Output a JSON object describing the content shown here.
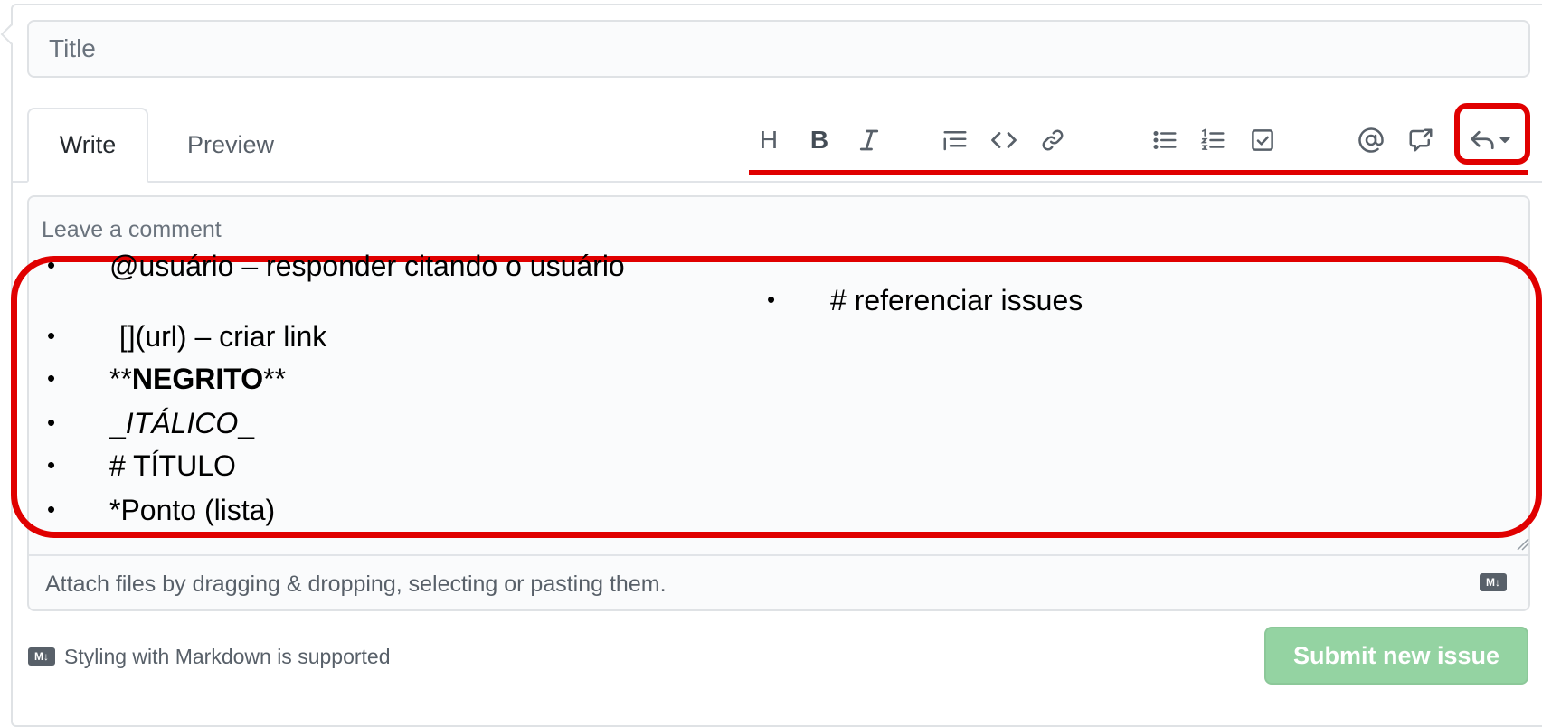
{
  "title_input": {
    "placeholder": "Title",
    "value": ""
  },
  "tabs": [
    {
      "label": "Write",
      "active": true
    },
    {
      "label": "Preview",
      "active": false
    }
  ],
  "toolbar": {
    "icons": [
      "heading-icon",
      "bold-icon",
      "italic-icon",
      "quote-icon",
      "code-icon",
      "link-icon",
      "bulleted-list-icon",
      "numbered-list-icon",
      "task-list-icon",
      "mention-icon",
      "cross-reference-icon",
      "reply-icon"
    ],
    "heading": "H",
    "bold": "B"
  },
  "editor": {
    "placeholder": "Leave a comment"
  },
  "hints": {
    "bullet": "•",
    "items": [
      "@usuário – responder citando o usuário",
      " [](url) – criar link",
      {
        "pre": "**",
        "bold": "NEGRITO",
        "post": "**"
      },
      {
        "pre": "_",
        "italic": "ITÁLICO",
        "post": "_"
      },
      "# TÍTULO",
      "*Ponto (lista)"
    ],
    "right_item": "# referenciar issues"
  },
  "attach": {
    "text": "Attach files by dragging & dropping, selecting or pasting them.",
    "md_badge": "M↓"
  },
  "footer": {
    "md_badge": "M↓",
    "text": "Styling with Markdown is supported"
  },
  "submit": {
    "label": "Submit new issue",
    "color": "#94d3a2"
  },
  "colors": {
    "highlight": "#e00000",
    "border": "#dfe2e5",
    "muted": "#586069"
  }
}
